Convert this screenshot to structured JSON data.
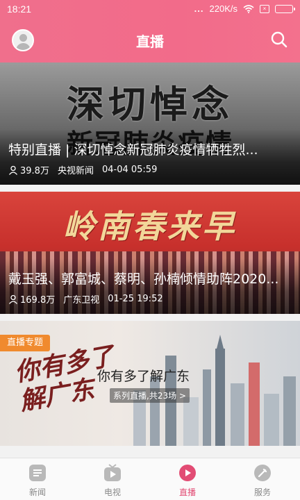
{
  "status_bar": {
    "time": "18:21",
    "dots": "...",
    "speed": "220K/s"
  },
  "header": {
    "title": "直播"
  },
  "colors": {
    "accent": "#f26b8a",
    "active_tab": "#e24c74",
    "badge": "#f08a2e"
  },
  "feed": {
    "cards": [
      {
        "art_text_1": "深切悼念",
        "art_text_2": "新冠肺炎疫情",
        "title": "特别直播 | 深切悼念新冠肺炎疫情牺牲烈...",
        "views": "39.8万",
        "channel": "央视新闻",
        "time": "04-04 05:59"
      },
      {
        "art_text_1": "岭南春来早",
        "title": "戴玉强、郭富城、蔡明、孙楠倾情助阵2020...",
        "views": "169.8万",
        "channel": "广东卫视",
        "time": "01-25 19:52"
      }
    ],
    "special": {
      "badge": "直播专题",
      "art_text": "你有多了解广东",
      "title": "你有多了解广东",
      "subtitle": "系列直播,共23场 >"
    }
  },
  "tabbar": {
    "tabs": [
      {
        "label": "新闻",
        "icon": "news-icon",
        "active": false
      },
      {
        "label": "电视",
        "icon": "tv-icon",
        "active": false
      },
      {
        "label": "直播",
        "icon": "live-icon",
        "active": true
      },
      {
        "label": "服务",
        "icon": "service-icon",
        "active": false
      }
    ]
  }
}
